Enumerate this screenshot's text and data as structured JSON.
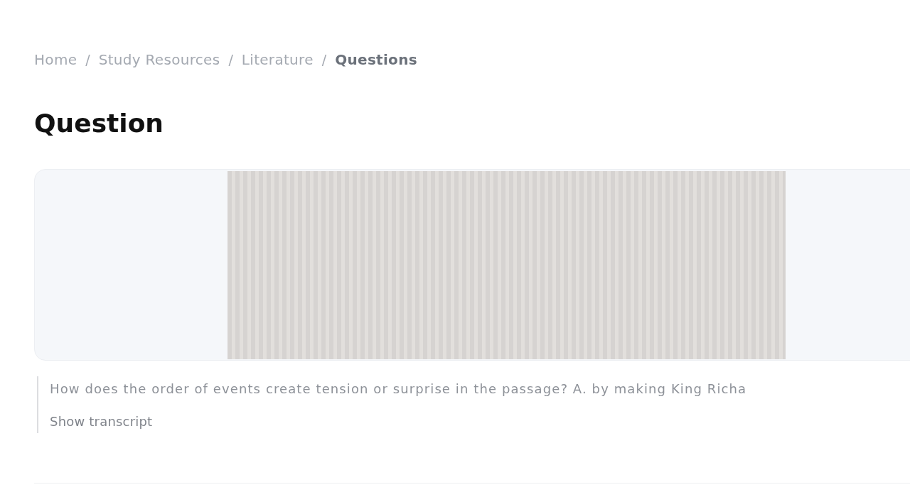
{
  "breadcrumb": [
    {
      "kind": "link",
      "text": "Home"
    },
    {
      "kind": "separator",
      "text": "/"
    },
    {
      "kind": "link",
      "text": "Study Resources"
    },
    {
      "kind": "separator",
      "text": "/"
    },
    {
      "kind": "link",
      "text": "Literature"
    },
    {
      "kind": "separator",
      "text": "/"
    },
    {
      "kind": "current",
      "text": "Questions"
    }
  ],
  "heading": "Question",
  "transcript": {
    "text": "How does the order of events create tension or surprise in the passage? A. by making King Richa",
    "toggle": "Show transcript"
  }
}
